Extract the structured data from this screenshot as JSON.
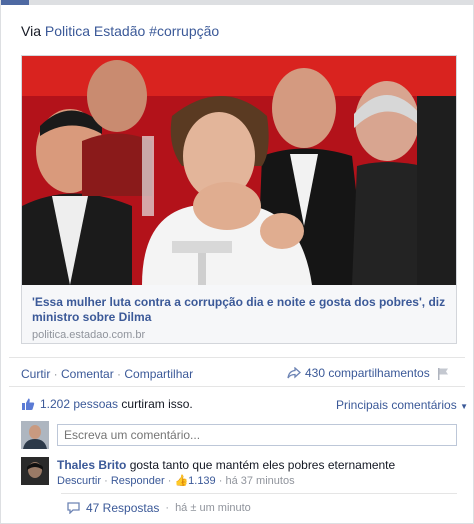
{
  "post": {
    "via_prefix": "Via ",
    "via_link": "Politica Estadão #corrupção"
  },
  "link": {
    "title": "'Essa mulher luta contra a corrupção dia e noite e gosta dos pobres', diz ministro sobre Dilma",
    "domain": "politica.estadao.com.br"
  },
  "actions": {
    "like": "Curtir",
    "comment": "Comentar",
    "share": "Compartilhar",
    "sep": " · ",
    "shares_count": "430 compartilhamentos"
  },
  "likes": {
    "count": "1.202 pessoas",
    "suffix": " curtiram isso.",
    "top_comments": "Principais comentários"
  },
  "composer": {
    "placeholder": "Escreva um comentário..."
  },
  "comment": {
    "author": "Thales Brito",
    "text": " gosta tanto que mantém eles pobres eternamente",
    "like": "Descurtir",
    "reply": "Responder",
    "likes": "1.139",
    "time": "há 37 minutos"
  },
  "replies": {
    "label": "47 Respostas",
    "time": "há ± um minuto"
  },
  "colors": {
    "link": "#3b5998",
    "muted": "#90949c",
    "photo_bg": "#c9141a"
  }
}
